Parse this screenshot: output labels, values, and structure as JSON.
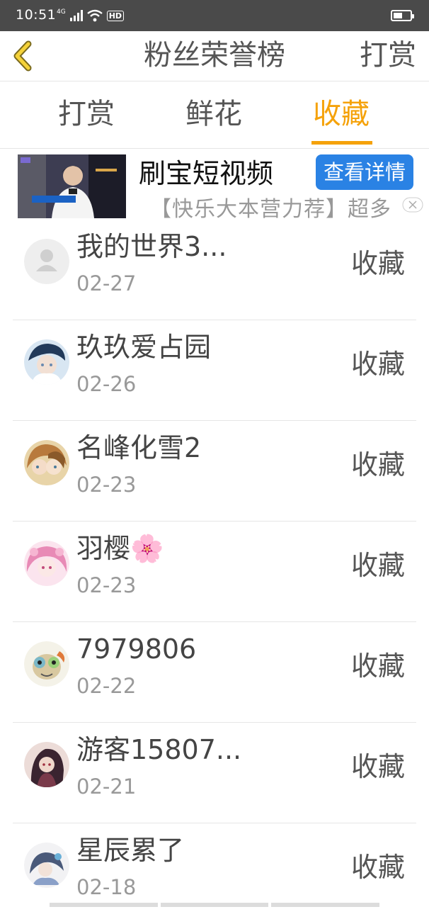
{
  "status_bar": {
    "time": "10:51",
    "network": "4G",
    "hd": "HD"
  },
  "header": {
    "title": "粉丝荣誉榜",
    "action": "打赏"
  },
  "tabs": [
    {
      "label": "打赏",
      "active": false
    },
    {
      "label": "鲜花",
      "active": false
    },
    {
      "label": "收藏",
      "active": true
    }
  ],
  "ad": {
    "title": "刷宝短视频",
    "button": "查看详情",
    "subtitle": "【快乐大本营力荐】超多"
  },
  "fans": [
    {
      "name": "我的世界3...",
      "date": "02-27",
      "action": "收藏",
      "avatar": "default-avatar"
    },
    {
      "name": "玖玖爱占园",
      "date": "02-26",
      "action": "收藏",
      "avatar": "anime-avatar"
    },
    {
      "name": "名峰化雪2",
      "date": "02-23",
      "action": "收藏",
      "avatar": "anime-avatar"
    },
    {
      "name": "羽樱🌸",
      "date": "02-23",
      "action": "收藏",
      "avatar": "anime-avatar"
    },
    {
      "name": "7979806",
      "date": "02-22",
      "action": "收藏",
      "avatar": "cartoon-avatar"
    },
    {
      "name": "游客15807...",
      "date": "02-21",
      "action": "收藏",
      "avatar": "anime-avatar"
    },
    {
      "name": "星辰累了",
      "date": "02-18",
      "action": "收藏",
      "avatar": "anime-avatar"
    }
  ],
  "colors": {
    "accent": "#f5a20a",
    "ad_button": "#2a82e4",
    "status_bar": "#4a4a4a"
  }
}
